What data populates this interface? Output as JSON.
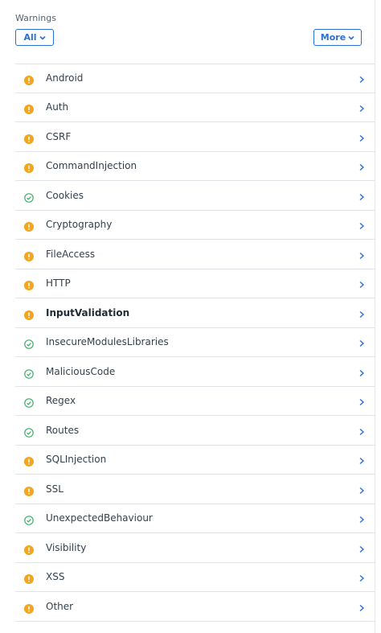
{
  "header": {
    "title": "Warnings",
    "filter_label": "All",
    "more_label": "More"
  },
  "colors": {
    "warning": "#f2a51f",
    "ok": "#3fae6a",
    "accent": "#2b6fd8"
  },
  "items": [
    {
      "label": "Android",
      "status": "warning",
      "icon": "warning-icon"
    },
    {
      "label": "Auth",
      "status": "warning",
      "icon": "warning-icon"
    },
    {
      "label": "CSRF",
      "status": "warning",
      "icon": "warning-icon"
    },
    {
      "label": "CommandInjection",
      "status": "warning",
      "icon": "warning-icon"
    },
    {
      "label": "Cookies",
      "status": "ok",
      "icon": "check-circle-icon"
    },
    {
      "label": "Cryptography",
      "status": "warning",
      "icon": "warning-icon"
    },
    {
      "label": "FileAccess",
      "status": "warning",
      "icon": "warning-icon"
    },
    {
      "label": "HTTP",
      "status": "warning",
      "icon": "warning-icon"
    },
    {
      "label": "InputValidation",
      "status": "warning",
      "icon": "warning-icon",
      "bold": true
    },
    {
      "label": "InsecureModulesLibraries",
      "status": "ok",
      "icon": "check-circle-icon"
    },
    {
      "label": "MaliciousCode",
      "status": "ok",
      "icon": "check-circle-icon"
    },
    {
      "label": "Regex",
      "status": "ok",
      "icon": "check-circle-icon"
    },
    {
      "label": "Routes",
      "status": "ok",
      "icon": "check-circle-icon"
    },
    {
      "label": "SQLInjection",
      "status": "warning",
      "icon": "warning-icon"
    },
    {
      "label": "SSL",
      "status": "warning",
      "icon": "warning-icon"
    },
    {
      "label": "UnexpectedBehaviour",
      "status": "ok",
      "icon": "check-circle-icon"
    },
    {
      "label": "Visibility",
      "status": "warning",
      "icon": "warning-icon"
    },
    {
      "label": "XSS",
      "status": "warning",
      "icon": "warning-icon"
    },
    {
      "label": "Other",
      "status": "warning",
      "icon": "warning-icon"
    }
  ]
}
